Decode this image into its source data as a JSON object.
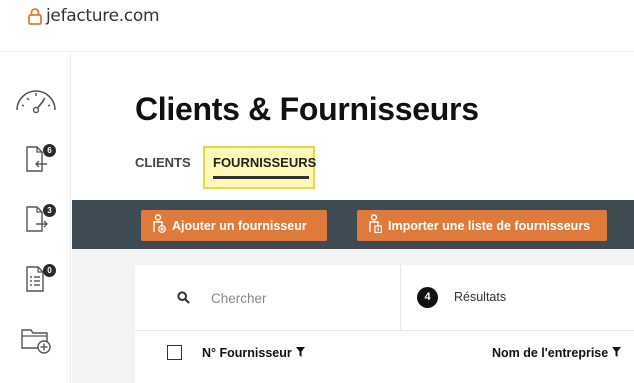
{
  "brand": {
    "name": "jefacture.com",
    "accent": "#e07a3a"
  },
  "sidebar": {
    "items": [
      {
        "name": "dashboard",
        "icon": "speedometer-icon",
        "badge": null
      },
      {
        "name": "incoming-documents",
        "icon": "document-in-icon",
        "badge": "6"
      },
      {
        "name": "outgoing-documents",
        "icon": "document-out-icon",
        "badge": "3"
      },
      {
        "name": "list-documents",
        "icon": "document-list-icon",
        "badge": "0"
      },
      {
        "name": "add-folder",
        "icon": "folder-add-icon",
        "badge": null
      }
    ]
  },
  "page": {
    "title": "Clients & Fournisseurs",
    "tabs": [
      {
        "label": "CLIENTS",
        "active": false
      },
      {
        "label": "FOURNISSEURS",
        "active": true
      }
    ]
  },
  "actions": {
    "add_label": "Ajouter un fournisseur",
    "import_label": "Importer une liste de fournisseurs"
  },
  "search": {
    "placeholder": "Chercher",
    "value": ""
  },
  "results": {
    "count": "4",
    "label": "Résultats"
  },
  "table": {
    "columns": [
      {
        "label": "N° Fournisseur",
        "filter_icon": "filter-icon"
      },
      {
        "label": "Nom de l'entreprise",
        "filter_icon": "filter-icon"
      }
    ]
  },
  "colors": {
    "header_bar": "#3e4b53",
    "button": "#e07a3a",
    "tab_highlight": "#fff9b8"
  }
}
